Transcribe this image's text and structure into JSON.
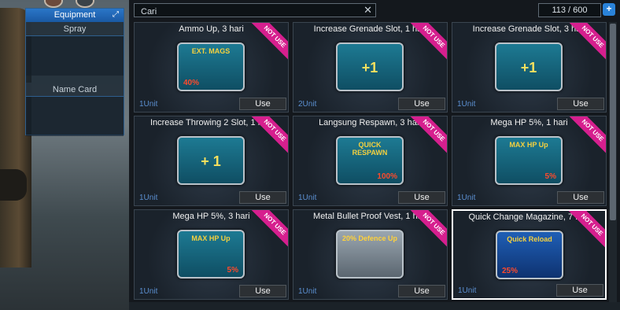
{
  "equipment": {
    "title": "Equipment",
    "rows": [
      "Spray",
      "Name Card"
    ]
  },
  "inventory": {
    "search": {
      "value": "Cari"
    },
    "count": "113 / 600",
    "items": [
      {
        "title": "Ammo Up, 3 hari",
        "badge": "NOT USE",
        "unit": "1Unit",
        "use": "Use",
        "img_label": "EXT. MAGS",
        "img_pct": "40%"
      },
      {
        "title": "Increase Grenade Slot, 1 hari",
        "badge": "NOT USE",
        "unit": "2Unit",
        "use": "Use",
        "img_big": "+1"
      },
      {
        "title": "Increase Grenade Slot, 3 hari",
        "badge": "NOT USE",
        "unit": "1Unit",
        "use": "Use",
        "img_big": "+1"
      },
      {
        "title": "Increase Throwing 2 Slot, 1 hari",
        "badge": "NOT USE",
        "unit": "1Unit",
        "use": "Use",
        "img_big": "+ 1"
      },
      {
        "title": "Langsung Respawn, 3 hari",
        "badge": "NOT USE",
        "unit": "1Unit",
        "use": "Use",
        "img_label": "QUICK RESPAWN",
        "img_pct": "100%"
      },
      {
        "title": "Mega HP 5%, 1 hari",
        "badge": "NOT USE",
        "unit": "1Unit",
        "use": "Use",
        "img_label": "MAX HP Up",
        "img_pct": "5%"
      },
      {
        "title": "Mega HP 5%, 3 hari",
        "badge": "NOT USE",
        "unit": "1Unit",
        "use": "Use",
        "img_label": "MAX HP Up",
        "img_pct": "5%"
      },
      {
        "title": "Metal Bullet Proof Vest, 1 hari",
        "badge": "NOT USE",
        "unit": "1Unit",
        "use": "Use",
        "img_label": "20% Defence Up",
        "img_pct": ""
      },
      {
        "title": "Quick Change Magazine, 7 hari",
        "badge": "NOT USE",
        "unit": "1Unit",
        "use": "Use",
        "img_label": "Quick Reload",
        "img_pct": "25%"
      }
    ]
  }
}
